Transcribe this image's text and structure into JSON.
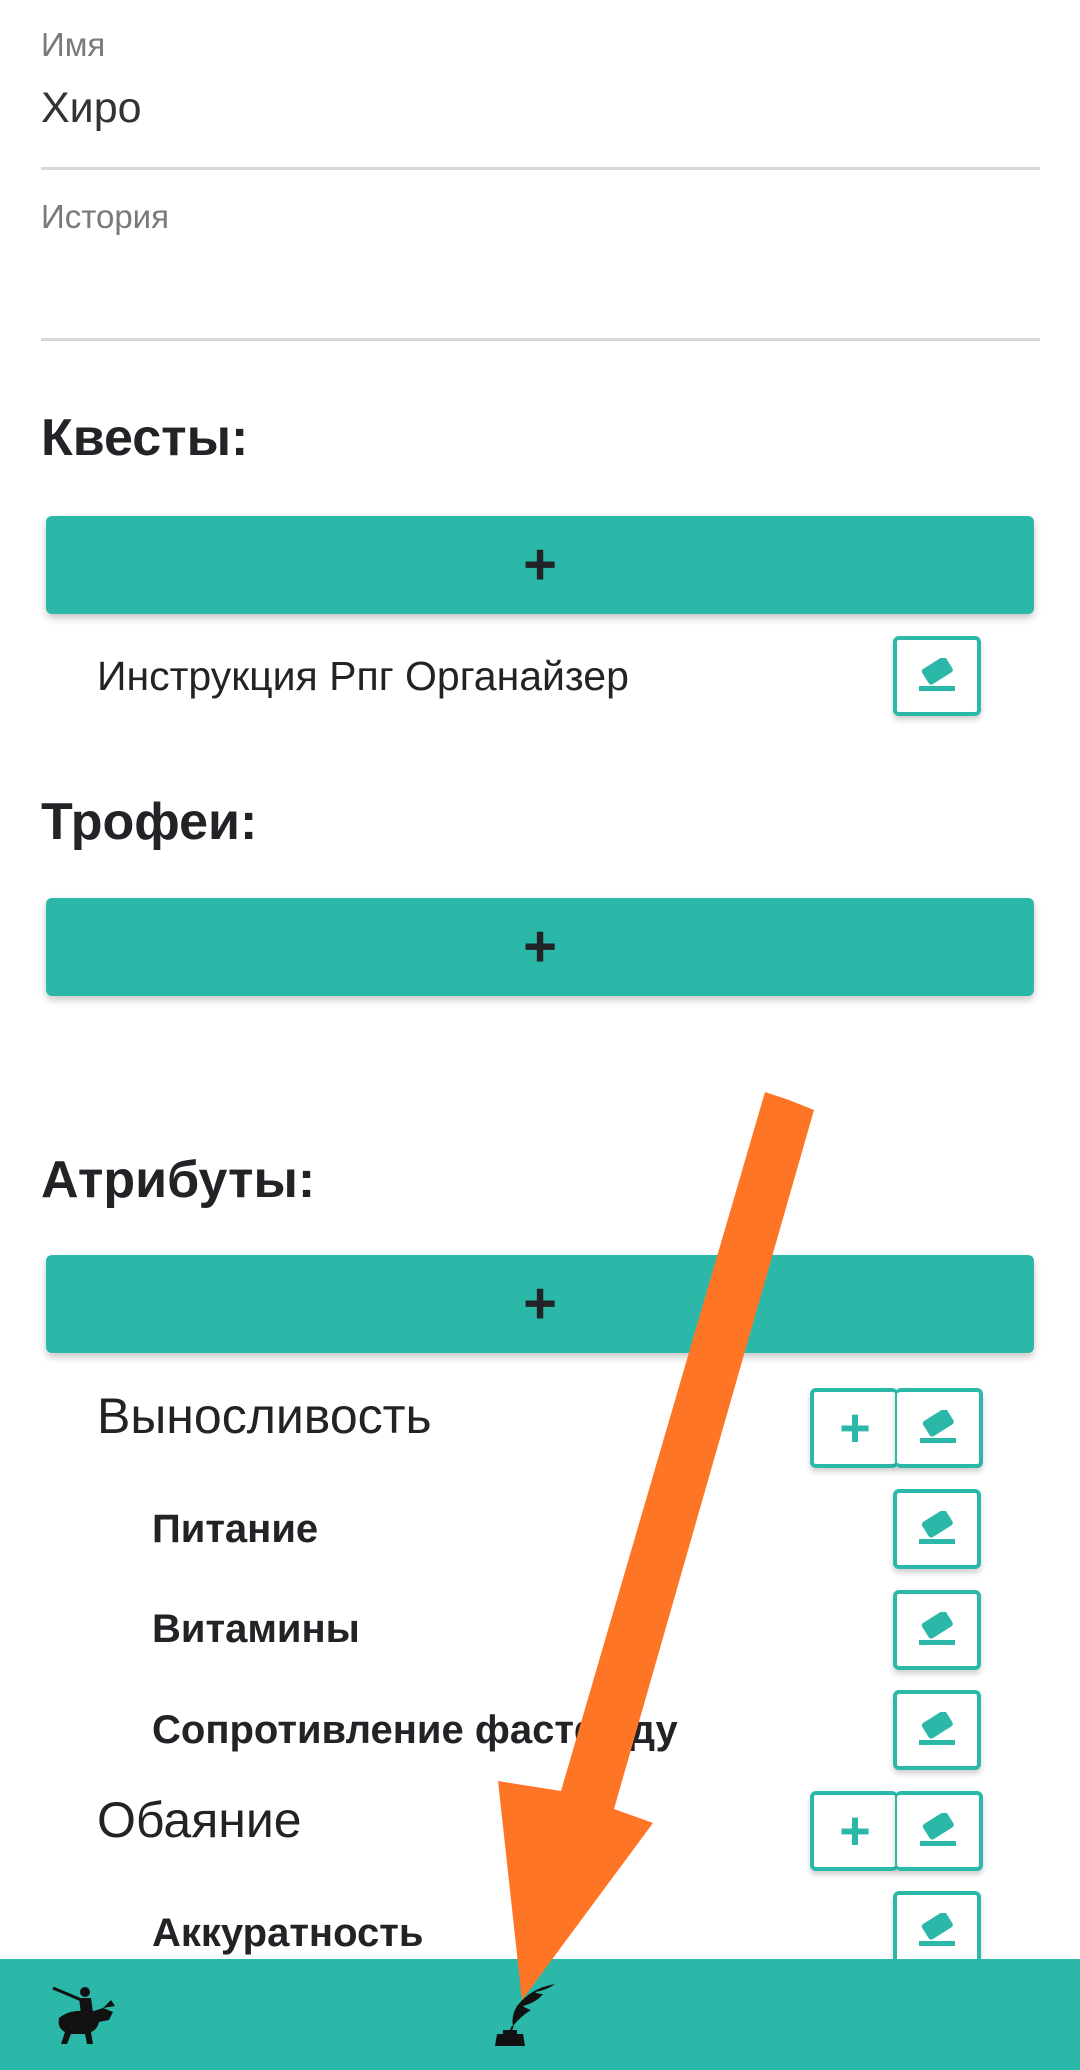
{
  "form": {
    "name_label": "Имя",
    "name_value": "Хиро",
    "history_label": "История",
    "history_value": ""
  },
  "sections": {
    "quests_title": "Квесты:",
    "trophies_title": "Трофеи:",
    "attributes_title": "Атрибуты:",
    "add_symbol": "+"
  },
  "quests": [
    {
      "name": "Инструкция Рпг Органайзер"
    }
  ],
  "attributes": [
    {
      "name": "Выносливость",
      "subs": [
        "Питание",
        "Витамины",
        "Сопротивление фастфуду"
      ]
    },
    {
      "name": "Обаяние",
      "subs": [
        "Аккуратность"
      ]
    }
  ],
  "icons": {
    "eraser": "eraser-icon",
    "plus": "plus-icon",
    "hero_tab": "knight-icon",
    "quill_tab": "quill-inkwell-icon"
  },
  "colors": {
    "accent": "#2bb8a9",
    "text": "#222326",
    "annotation_arrow": "#ff7526"
  }
}
